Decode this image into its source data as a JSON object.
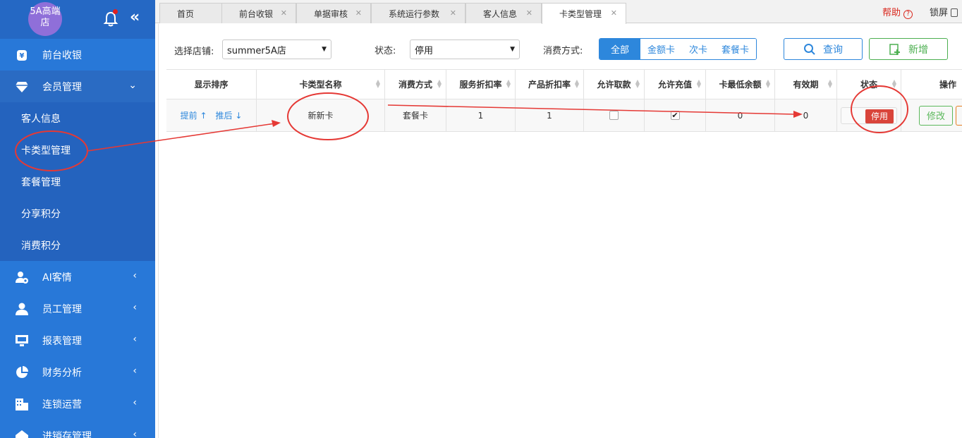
{
  "sidebar": {
    "store_name": "5A高端店",
    "icons": {
      "bell": "bell-icon",
      "collapse": "double-chevron-left-icon"
    },
    "items": [
      {
        "label": "前台收银",
        "icon": "yen-icon"
      },
      {
        "label": "会员管理",
        "icon": "diamond-icon",
        "open": true,
        "children": [
          "客人信息",
          "卡类型管理",
          "套餐管理",
          "分享积分",
          "消费积分"
        ]
      },
      {
        "label": "AI客情",
        "icon": "user-ai-icon"
      },
      {
        "label": "员工管理",
        "icon": "user-icon"
      },
      {
        "label": "报表管理",
        "icon": "monitor-icon"
      },
      {
        "label": "财务分析",
        "icon": "pie-chart-icon"
      },
      {
        "label": "连锁运营",
        "icon": "building-icon"
      },
      {
        "label": "进销存管理",
        "icon": "warehouse-icon"
      }
    ]
  },
  "tabs": [
    {
      "label": "首页",
      "closable": false
    },
    {
      "label": "前台收银",
      "closable": true
    },
    {
      "label": "单据审核",
      "closable": true
    },
    {
      "label": "系统运行参数",
      "closable": true
    },
    {
      "label": "客人信息",
      "closable": true
    },
    {
      "label": "卡类型管理",
      "closable": true,
      "active": true
    }
  ],
  "topright": {
    "help": "帮助",
    "lock": "锁屏"
  },
  "filters": {
    "store_label": "选择店铺:",
    "store_value": "summer5A店",
    "status_label": "状态:",
    "status_value": "停用",
    "pay_label": "消费方式:",
    "pay_options": [
      "全部",
      "金额卡",
      "次卡",
      "套餐卡"
    ],
    "pay_active": "全部",
    "query_label": "查询",
    "add_label": "新增"
  },
  "table": {
    "headers": [
      "显示排序",
      "卡类型名称",
      "消费方式",
      "服务折扣率",
      "产品折扣率",
      "允许取款",
      "允许充值",
      "卡最低余额",
      "有效期",
      "状态",
      "操作"
    ],
    "rows": [
      {
        "order_up": "提前",
        "order_down": "推后",
        "name": "新新卡",
        "pay_type": "套餐卡",
        "service_discount": "1",
        "product_discount": "1",
        "allow_withdraw": false,
        "allow_recharge": true,
        "min_balance": "0",
        "validity": "0",
        "status": "停用",
        "edit": "修改"
      }
    ]
  },
  "colors": {
    "sidebar": "#2878d8",
    "accent": "#2d87dc",
    "annotation": "#e53935",
    "disabled": "#d9443a",
    "success": "#5cb85c"
  }
}
